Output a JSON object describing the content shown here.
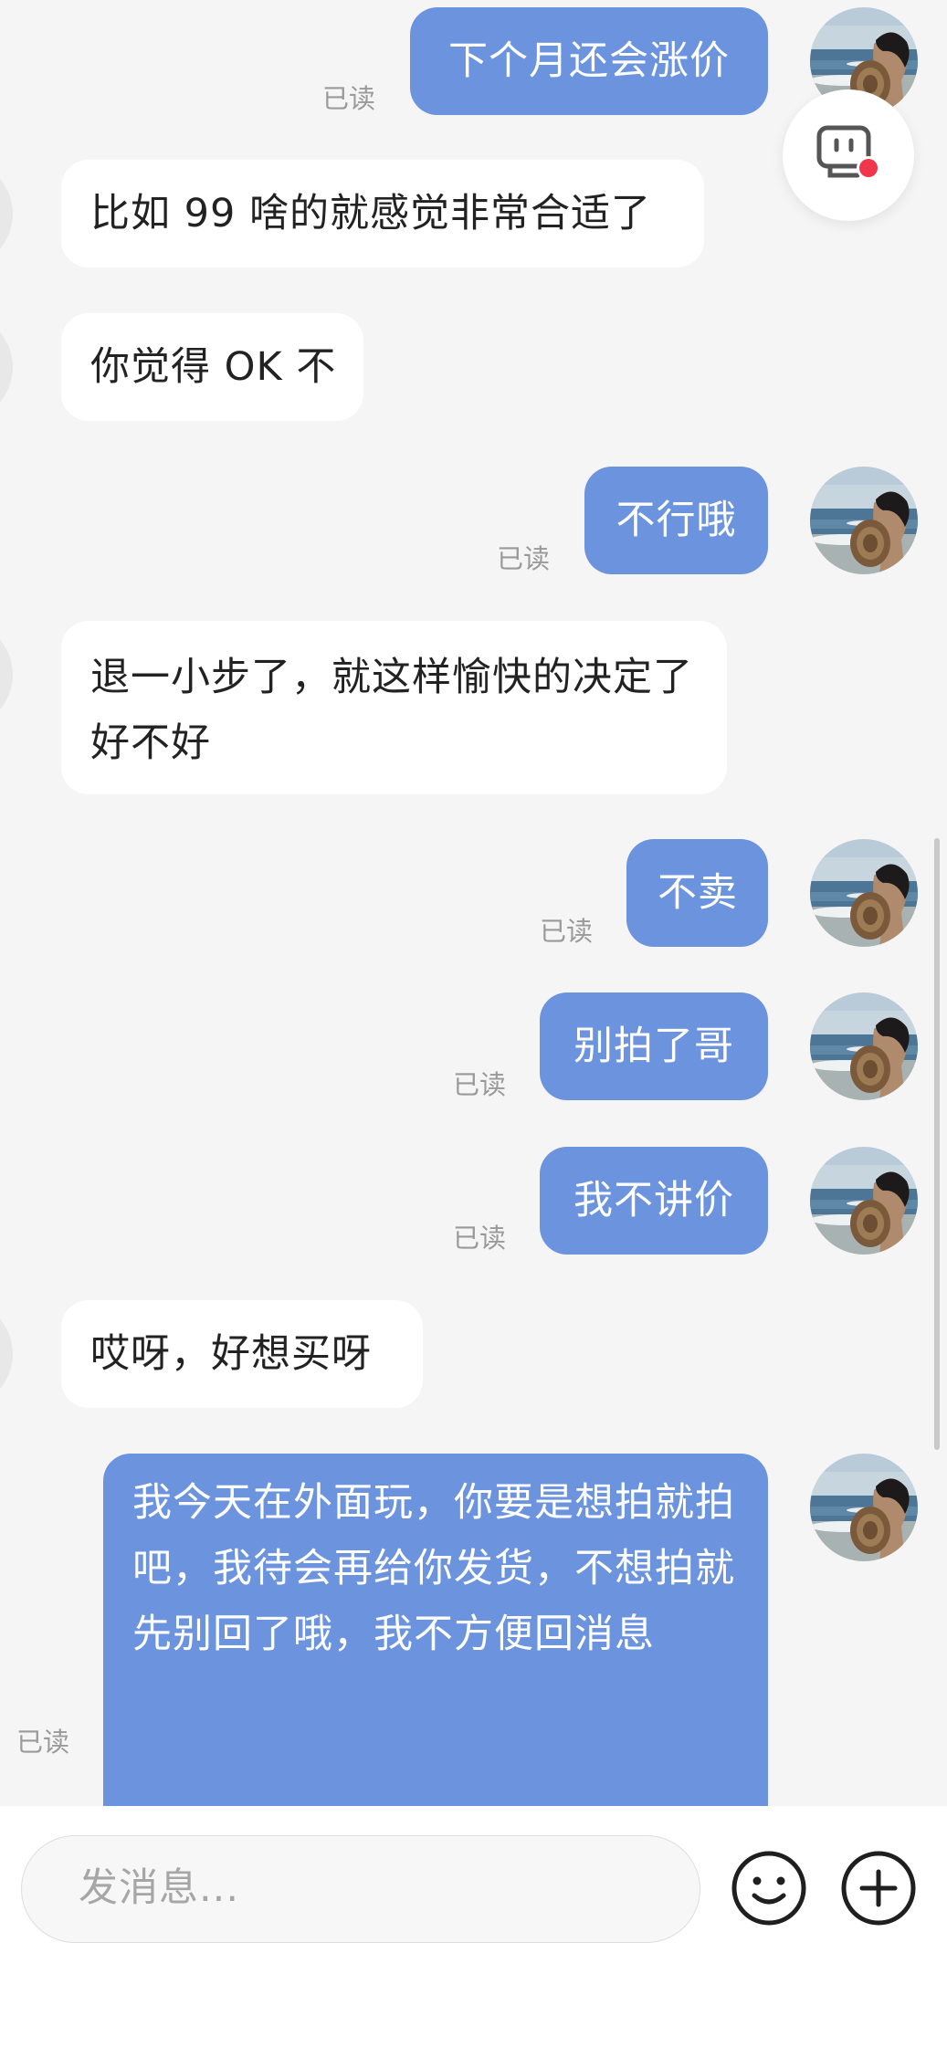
{
  "messages": [
    {
      "side": "sent",
      "text": "下个月还会涨价",
      "read": "已读"
    },
    {
      "side": "received",
      "text": "比如 99 啥的就感觉非常合适了"
    },
    {
      "side": "received",
      "text": "你觉得 OK 不"
    },
    {
      "side": "sent",
      "text": "不行哦",
      "read": "已读"
    },
    {
      "side": "received",
      "text": "退一小步了，就这样愉快的决定了好不好"
    },
    {
      "side": "sent",
      "text": "不卖",
      "read": "已读"
    },
    {
      "side": "sent",
      "text": "别拍了哥",
      "read": "已读"
    },
    {
      "side": "sent",
      "text": "我不讲价",
      "read": "已读"
    },
    {
      "side": "received",
      "text": "哎呀，好想买呀"
    },
    {
      "side": "sent",
      "text": "我今天在外面玩，你要是想拍就拍吧，我待会再给你发货，不想拍就先别回了哦，我不方便回消息",
      "read": "已读"
    }
  ],
  "input": {
    "placeholder": "发消息..."
  },
  "icons": {
    "float_button": "robot-assistant-icon",
    "emoji": "smiley-face-icon",
    "add": "plus-circle-icon",
    "avatar": "beach-photo-avatar"
  },
  "colors": {
    "sent_bubble": "#6b93de",
    "received_bubble": "#ffffff",
    "background": "#f5f5f5",
    "notification_dot": "#f0364a"
  }
}
